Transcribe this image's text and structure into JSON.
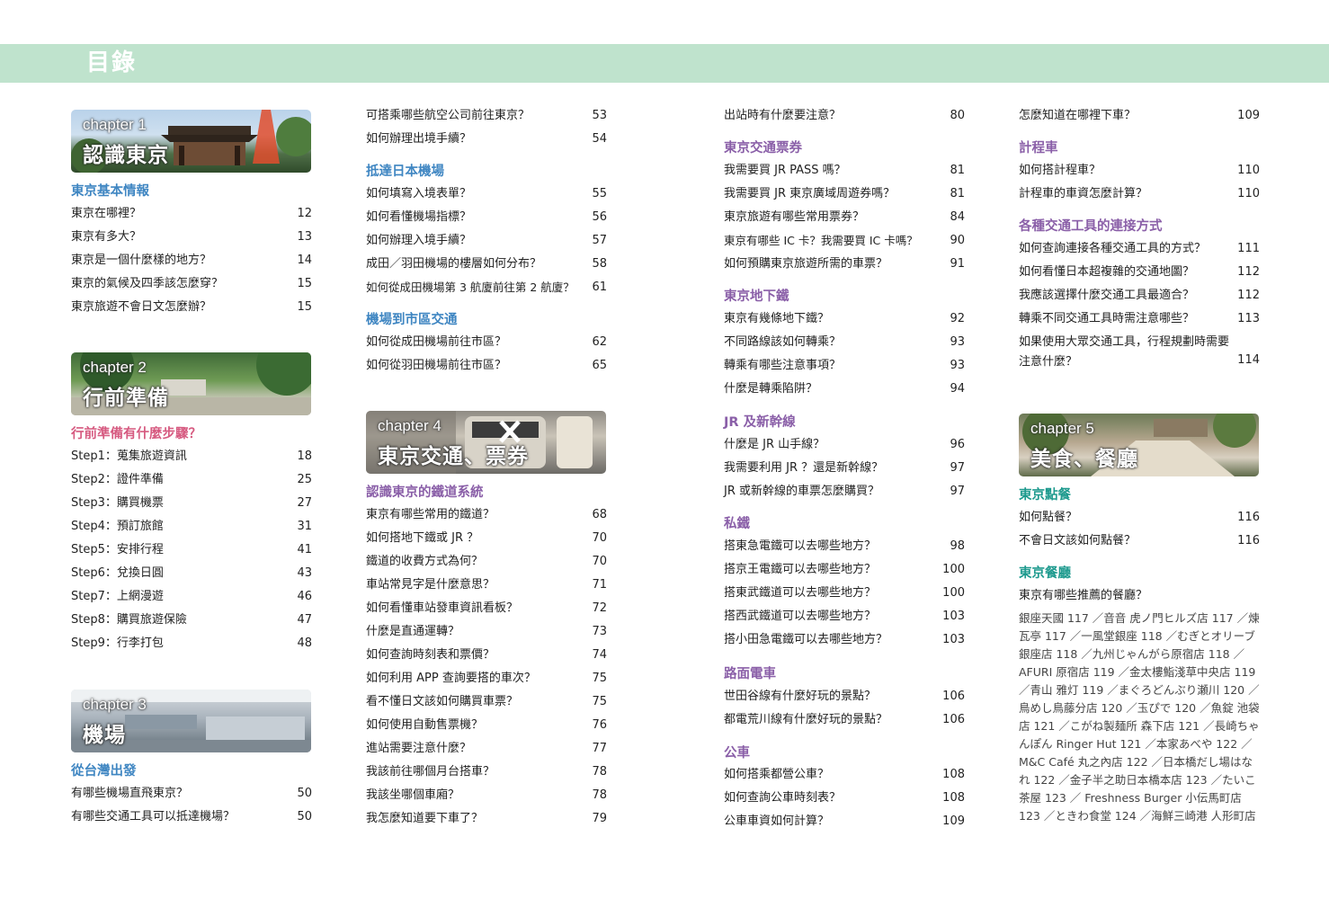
{
  "page_title": "目錄",
  "col1": {
    "chapter1": {
      "chapter": "chapter 1",
      "title": "認識東京"
    },
    "sec1": "東京基本情報",
    "sec1_items": [
      {
        "t": "東京在哪裡？",
        "p": "12"
      },
      {
        "t": "東京有多大？",
        "p": "13"
      },
      {
        "t": "東京是一個什麼樣的地方？",
        "p": "14"
      },
      {
        "t": "東京的氣候及四季該怎麼穿？",
        "p": "15"
      },
      {
        "t": "東京旅遊不會日文怎麼辦？",
        "p": "15"
      }
    ],
    "chapter2": {
      "chapter": "chapter 2",
      "title": "行前準備"
    },
    "sec2": "行前準備有什麼步驟？",
    "sec2_items": [
      {
        "t": "Step1：蒐集旅遊資訊",
        "p": "18"
      },
      {
        "t": "Step2：證件準備",
        "p": "25"
      },
      {
        "t": "Step3：購買機票",
        "p": "27"
      },
      {
        "t": "Step4：預訂旅館",
        "p": "31"
      },
      {
        "t": "Step5：安排行程",
        "p": "41"
      },
      {
        "t": "Step6：兌換日圓",
        "p": "43"
      },
      {
        "t": "Step7：上網漫遊",
        "p": "46"
      },
      {
        "t": "Step8：購買旅遊保險",
        "p": "47"
      },
      {
        "t": "Step9：行李打包",
        "p": "48"
      }
    ],
    "chapter3": {
      "chapter": "chapter 3",
      "title": "機場"
    },
    "sec3": "從台灣出發",
    "sec3_items": [
      {
        "t": "有哪些機場直飛東京？",
        "p": "50"
      },
      {
        "t": "有哪些交通工具可以抵達機場？",
        "p": "50"
      }
    ]
  },
  "col2": {
    "top_items": [
      {
        "t": "可搭乘哪些航空公司前往東京？",
        "p": "53"
      },
      {
        "t": "如何辦理出境手續？",
        "p": "54"
      }
    ],
    "sec1": "抵達日本機場",
    "sec1_items": [
      {
        "t": "如何填寫入境表單？",
        "p": "55"
      },
      {
        "t": "如何看懂機場指標？",
        "p": "56"
      },
      {
        "t": "如何辦理入境手續？",
        "p": "57"
      },
      {
        "t": "成田／羽田機場的樓層如何分布？",
        "p": "58"
      },
      {
        "t": "如何從成田機場第 3 航廈前往第 2 航廈？",
        "p": "61"
      }
    ],
    "sec2": "機場到市區交通",
    "sec2_items": [
      {
        "t": "如何從成田機場前往市區？",
        "p": "62"
      },
      {
        "t": "如何從羽田機場前往市區？",
        "p": "65"
      }
    ],
    "chapter4": {
      "chapter": "chapter 4",
      "title": "東京交通、票券"
    },
    "sec3": "認識東京的鐵道系統",
    "sec3_items": [
      {
        "t": "東京有哪些常用的鐵道？",
        "p": "68"
      },
      {
        "t": "如何搭地下鐵或 JR ？",
        "p": "70"
      },
      {
        "t": "鐵道的收費方式為何？",
        "p": "70"
      },
      {
        "t": "車站常見字是什麼意思？",
        "p": "71"
      },
      {
        "t": "如何看懂車站發車資訊看板？",
        "p": "72"
      },
      {
        "t": "什麼是直通運轉？",
        "p": "73"
      },
      {
        "t": "如何查詢時刻表和票價？",
        "p": "74"
      },
      {
        "t": "如何利用 APP 查詢要搭的車次？",
        "p": "75"
      },
      {
        "t": "看不懂日文該如何購買車票？",
        "p": "75"
      },
      {
        "t": "如何使用自動售票機？",
        "p": "76"
      },
      {
        "t": "進站需要注意什麼？",
        "p": "77"
      },
      {
        "t": "我該前往哪個月台搭車？",
        "p": "78"
      },
      {
        "t": "我該坐哪個車廂？",
        "p": "78"
      },
      {
        "t": "我怎麼知道要下車了？",
        "p": "79"
      }
    ]
  },
  "col3": {
    "top_items": [
      {
        "t": "出站時有什麼要注意？",
        "p": "80"
      }
    ],
    "sec1": "東京交通票券",
    "sec1_items": [
      {
        "t": "我需要買 JR PASS 嗎？",
        "p": "81"
      },
      {
        "t": "我需要買 JR 東京廣域周遊券嗎？",
        "p": "81"
      },
      {
        "t": "東京旅遊有哪些常用票券？",
        "p": "84"
      },
      {
        "t": "東京有哪些 IC 卡？我需要買 IC 卡嗎？",
        "p": "90"
      },
      {
        "t": "如何預購東京旅遊所需的車票？",
        "p": "91"
      }
    ],
    "sec2": "東京地下鐵",
    "sec2_items": [
      {
        "t": "東京有幾條地下鐵？",
        "p": "92"
      },
      {
        "t": "不同路線該如何轉乘？",
        "p": "93"
      },
      {
        "t": "轉乘有哪些注意事項？",
        "p": "93"
      },
      {
        "t": "什麼是轉乘陷阱？",
        "p": "94"
      }
    ],
    "sec3": "JR 及新幹線",
    "sec3_items": [
      {
        "t": "什麼是 JR 山手線？",
        "p": "96"
      },
      {
        "t": "我需要利用 JR ？還是新幹線？",
        "p": "97"
      },
      {
        "t": "JR 或新幹線的車票怎麼購買？",
        "p": "97"
      }
    ],
    "sec4": "私鐵",
    "sec4_items": [
      {
        "t": "搭東急電鐵可以去哪些地方？",
        "p": "98"
      },
      {
        "t": "搭京王電鐵可以去哪些地方？",
        "p": "100"
      },
      {
        "t": "搭東武鐵道可以去哪些地方？",
        "p": "100"
      },
      {
        "t": "搭西武鐵道可以去哪些地方？",
        "p": "103"
      },
      {
        "t": "搭小田急電鐵可以去哪些地方？",
        "p": "103"
      }
    ],
    "sec5": "路面電車",
    "sec5_items": [
      {
        "t": "世田谷線有什麼好玩的景點？",
        "p": "106"
      },
      {
        "t": "都電荒川線有什麼好玩的景點？",
        "p": "106"
      }
    ],
    "sec6": "公車",
    "sec6_items": [
      {
        "t": "如何搭乘都營公車？",
        "p": "108"
      },
      {
        "t": "如何查詢公車時刻表？",
        "p": "108"
      },
      {
        "t": "公車車資如何計算？",
        "p": "109"
      }
    ]
  },
  "col4": {
    "top_items": [
      {
        "t": "怎麼知道在哪裡下車？",
        "p": "109"
      }
    ],
    "sec1": "計程車",
    "sec1_items": [
      {
        "t": "如何搭計程車？",
        "p": "110"
      },
      {
        "t": "計程車的車資怎麼計算？",
        "p": "110"
      }
    ],
    "sec2": "各種交通工具的連接方式",
    "sec2_items": [
      {
        "t": "如何查詢連接各種交通工具的方式？",
        "p": "111"
      },
      {
        "t": "如何看懂日本超複雜的交通地圖？",
        "p": "112"
      },
      {
        "t": "我應該選擇什麼交通工具最適合？",
        "p": "112"
      },
      {
        "t": "轉乘不同交通工具時需注意哪些？",
        "p": "113"
      }
    ],
    "sec2_long": {
      "t": "如果使用大眾交通工具，行程規劃時需要注意什麼？",
      "p": "114"
    },
    "chapter5": {
      "chapter": "chapter 5",
      "title": "美食、餐廳"
    },
    "sec3": "東京點餐",
    "sec3_items": [
      {
        "t": "如何點餐？",
        "p": "116"
      },
      {
        "t": "不會日文該如何點餐？",
        "p": "116"
      }
    ],
    "sec4": "東京餐廳",
    "sec4_question": "東京有哪些推薦的餐廳？",
    "restaurants": "銀座天國 117 ／音音 虎ノ門ヒルズ店 117 ／煉瓦亭 117 ／一風堂銀座 118 ／むぎとオリーブ 銀座店 118 ／九州じゃんがら原宿店 118 ／AFURI 原宿店 119 ／金太樓鮨淺草中央店 119 ／青山 雅灯 119 ／まぐろどんぶり瀬川 120 ／鳥めし鳥藤分店 120 ／玉ぴで 120 ／魚錠 池袋店 121 ／こがね製麺所 森下店 121 ／長崎ちゃんぽん Ringer Hut 121 ／本家あべや 122 ／ M&C Café 丸之內店 122 ／日本橋だし場はなれ 122 ／金子半之助日本橋本店 123 ／たいこ茶屋 123 ／ Freshness Burger 小伝馬町店 123 ／ときわ食堂 124 ／海鮮三崎港 人形町店"
  }
}
